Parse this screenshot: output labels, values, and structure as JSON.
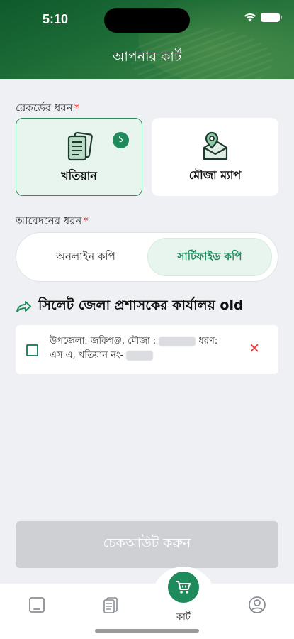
{
  "status_bar": {
    "time": "5:10"
  },
  "header": {
    "title": "আপনার কার্ট"
  },
  "record_type": {
    "label": "রেকর্ডের ধরন",
    "required_mark": "*",
    "options": [
      {
        "label": "খতিয়ান",
        "icon": "document-icon",
        "badge": "১",
        "selected": true
      },
      {
        "label": "মৌজা ম্যাপ",
        "icon": "map-pin-icon",
        "selected": false
      }
    ]
  },
  "application_type": {
    "label": "আবেদনের ধরন",
    "required_mark": "*",
    "options": [
      {
        "label": "অনলাইন কপি",
        "selected": false
      },
      {
        "label": "সার্টিফাইড কপি",
        "selected": true
      }
    ]
  },
  "office": {
    "icon": "share-arrow-icon",
    "title": "সিলেট জেলা প্রশাসকের কার্যালয় old"
  },
  "cart_item": {
    "line1_prefix": "উপজেলা: জকিগঞ্জ, মৌজা :",
    "line1_suffix": "ধরণ:",
    "line2_prefix": "এস এ, খতিয়ান নং-",
    "remove_icon": "close-icon",
    "checked": false
  },
  "checkout": {
    "label": "চেকআউট করুন",
    "enabled": false
  },
  "tabbar": {
    "items": [
      {
        "icon": "home-icon"
      },
      {
        "icon": "documents-icon"
      },
      {
        "icon": "cart-icon",
        "label": "কার্ট",
        "active": true
      },
      {
        "icon": "profile-icon"
      }
    ]
  },
  "colors": {
    "accent": "#1f8a5b",
    "danger": "#e53935",
    "header": "#1c6b36",
    "disabled": "#cfd0d4"
  }
}
